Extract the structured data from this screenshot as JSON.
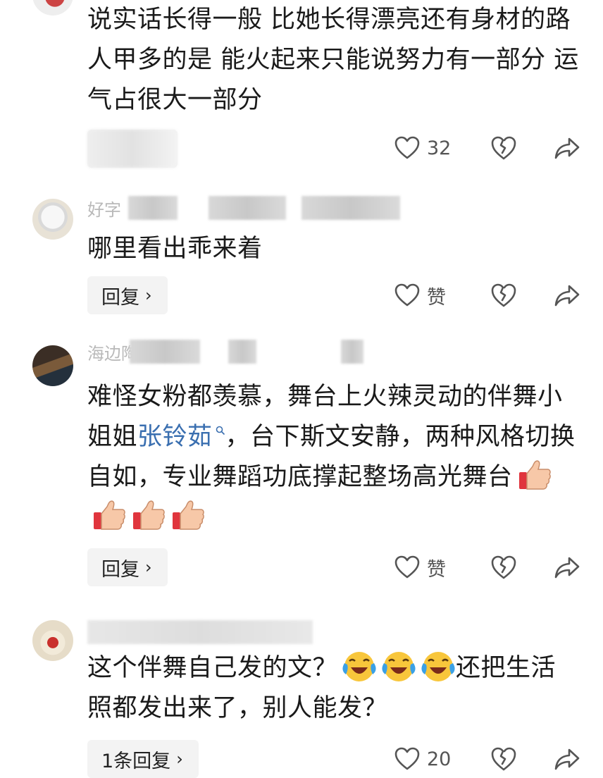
{
  "comments": [
    {
      "author_meta": "",
      "text": "说实话长得一般 比她长得漂亮还有身材的路人甲多的是 能火起来只能说努力有一部分 运气占很大一部分",
      "reply_label": "",
      "like_label": "32"
    },
    {
      "author_meta": "好字",
      "text": "哪里看出乖来着",
      "reply_label": "回复",
      "like_label": "赞"
    },
    {
      "author_meta": "海边陶醉着",
      "text_parts": [
        "难怪女粉都羡慕，舞台上火辣灵动的伴舞小姐姐",
        "张铃茹",
        "，台下斯文安静，两种风格切换自如，专业舞蹈功底撑起整场高光舞台"
      ],
      "reply_label": "回复",
      "like_label": "赞"
    },
    {
      "author_meta": "",
      "text_parts": [
        "这个伴舞自己发的文？",
        "还把生活照都发出来了，别人能发？"
      ],
      "reply_label": "1条回复",
      "like_label": "20"
    }
  ],
  "icons": {
    "like": "heart-outline-icon",
    "dislike": "broken-heart-icon",
    "share": "share-arrow-icon",
    "thumbs": "thumbs-up-emoji",
    "laugh": "crying-laughing-emoji"
  },
  "colors": {
    "link": "#3a6fb0",
    "reply_bg": "#f3f3f3"
  }
}
